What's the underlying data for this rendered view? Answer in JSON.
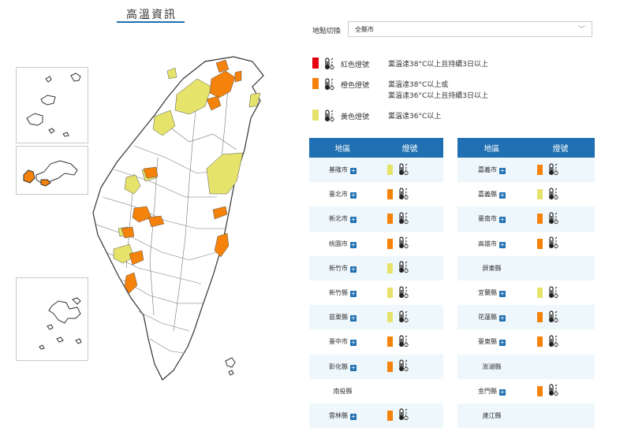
{
  "title": "高溫資訊",
  "location": {
    "label": "地點切換",
    "selected": "全縣市"
  },
  "colors": {
    "red": "#e60012",
    "orange": "#f5820a",
    "yellow": "#e6e36b",
    "header": "#1f6fb2"
  },
  "legend": [
    {
      "color": "red",
      "name": "紅色燈號",
      "lines": [
        "黨溫達38°C以上且持續3日以上"
      ]
    },
    {
      "color": "orange",
      "name": "橙色燈號",
      "lines": [
        "黨溫達38°C以上或",
        "黨溫達36°C以上且持續3日以上"
      ]
    },
    {
      "color": "yellow",
      "name": "黃色燈號",
      "lines": [
        "黨溫達36°C以上"
      ]
    }
  ],
  "table_headers": {
    "region": "地區",
    "light": "燈號"
  },
  "left_table": [
    {
      "name": "基隆市",
      "level": "yellow"
    },
    {
      "name": "臺北市",
      "level": "orange"
    },
    {
      "name": "新北市",
      "level": "orange"
    },
    {
      "name": "桃園市",
      "level": "orange"
    },
    {
      "name": "新竹市",
      "level": "yellow"
    },
    {
      "name": "新竹縣",
      "level": "yellow"
    },
    {
      "name": "苗栗縣",
      "level": "yellow"
    },
    {
      "name": "臺中市",
      "level": "orange"
    },
    {
      "name": "彰化縣",
      "level": "orange"
    },
    {
      "name": "南投縣",
      "level": ""
    },
    {
      "name": "雲林縣",
      "level": "orange"
    }
  ],
  "right_table": [
    {
      "name": "嘉義市",
      "level": "orange"
    },
    {
      "name": "嘉義縣",
      "level": "yellow"
    },
    {
      "name": "臺南市",
      "level": "orange"
    },
    {
      "name": "高雄市",
      "level": "orange"
    },
    {
      "name": "屏東縣",
      "level": ""
    },
    {
      "name": "宜蘭縣",
      "level": "yellow"
    },
    {
      "name": "花蓮縣",
      "level": "orange"
    },
    {
      "name": "臺東縣",
      "level": "orange"
    },
    {
      "name": "澎湖縣",
      "level": ""
    },
    {
      "name": "金門縣",
      "level": "orange"
    },
    {
      "name": "連江縣",
      "level": ""
    }
  ]
}
